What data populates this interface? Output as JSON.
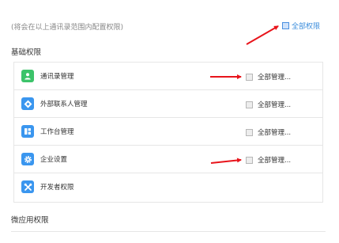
{
  "header": {
    "note": "(将会在以上通讯录范围内配置权限)",
    "all_permissions_label": "全部权限"
  },
  "sections": {
    "basic_title": "基础权限",
    "micro_title": "微应用权限"
  },
  "permissions": [
    {
      "label": "通讯录管理",
      "icon": "contacts-icon",
      "color": "#3cc36a",
      "check_label": "全部管理..."
    },
    {
      "label": "外部联系人管理",
      "icon": "external-contacts-icon",
      "color": "#3a96ef",
      "check_label": "全部管理..."
    },
    {
      "label": "工作台管理",
      "icon": "workbench-icon",
      "color": "#3a96ef",
      "check_label": "全部管理..."
    },
    {
      "label": "企业设置",
      "icon": "settings-gear-icon",
      "color": "#3a96ef",
      "check_label": "全部管理..."
    },
    {
      "label": "开发者权限",
      "icon": "developer-tools-icon",
      "color": "#3a96ef",
      "check_label": ""
    }
  ],
  "colors": {
    "accent": "#3b8ddc",
    "arrow": "#e8141b",
    "contacts_green": "#3cc36a",
    "icon_blue": "#3a96ef"
  }
}
